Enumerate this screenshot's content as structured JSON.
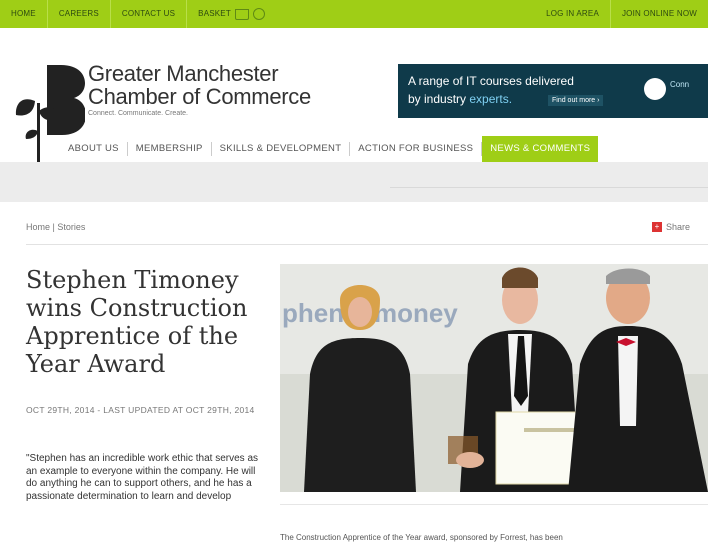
{
  "topbar": {
    "links": [
      "HOME",
      "CAREERS",
      "CONTACT US",
      "BASKET"
    ],
    "right_links": [
      "LOG IN AREA",
      "JOIN ONLINE NOW"
    ]
  },
  "header": {
    "org_line1": "Greater Manchester",
    "org_line2": "Chamber of Commerce",
    "tagline": "Connect. Communicate. Create.",
    "banner_line1": "A range of IT courses delivered",
    "banner_line2_a": "by industry ",
    "banner_line2_b": "experts.",
    "banner_button": "Find out more",
    "banner_logo_text": "Conn"
  },
  "nav": {
    "items": [
      "ABOUT US",
      "MEMBERSHIP",
      "SKILLS & DEVELOPMENT",
      "ACTION FOR BUSINESS",
      "NEWS & COMMENTS"
    ]
  },
  "breadcrumb": "Home | Stories",
  "share_label": "Share",
  "article": {
    "title": "Stephen Timoney wins Construction Apprentice of the Year Award",
    "meta": "OCT 29TH, 2014 - LAST UPDATED AT OCT 29TH, 2014",
    "quote": "\"Stephen has an incredible work ethic that serves as an example to everyone within the company. He will do anything he can to support others, and he has a passionate determination to learn and develop",
    "photo_backdrop_text": "phen Timoney",
    "caption": "The Construction Apprentice of the Year award, sponsored by Forrest, has been"
  },
  "colors": {
    "brand_green": "#9fce16",
    "banner_navy": "#0f3a4a",
    "share_red": "#dd3333"
  }
}
